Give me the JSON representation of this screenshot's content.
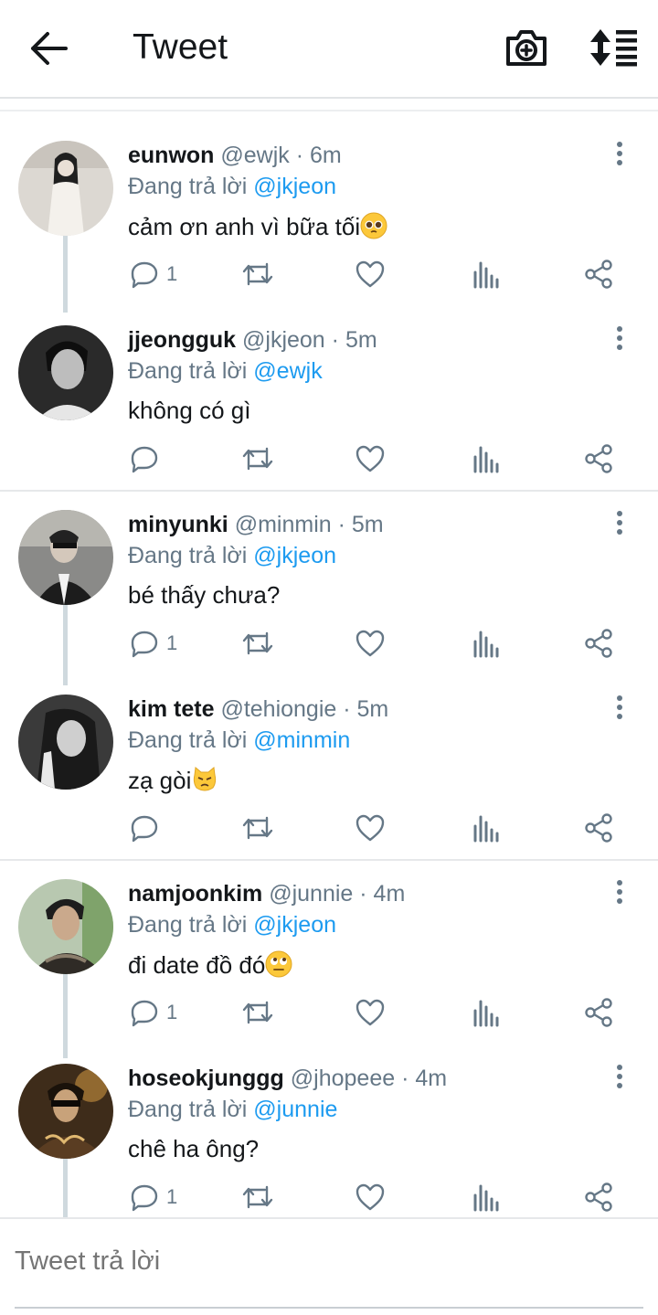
{
  "header": {
    "title": "Tweet",
    "back_icon": "arrow-left-icon",
    "camera_icon": "camera-plus-icon",
    "sort_icon": "sort-list-icon"
  },
  "colors": {
    "accent": "#1d9bf0",
    "muted": "#657786",
    "text": "#14171a",
    "thread_line": "#cfd9de"
  },
  "tweets": [
    {
      "name": "eunwon",
      "handle": "@ewjk",
      "time": "· 6m",
      "reply_prefix": "Đang trả lời",
      "reply_to": "@jkjeon",
      "text": "cảm ơn anh vì bữa tối",
      "emoji": "pleading-face",
      "reply_count": "1"
    },
    {
      "name": "jjeongguk",
      "handle": "@jkjeon",
      "time": "· 5m",
      "reply_prefix": "Đang trả lời",
      "reply_to": "@ewjk",
      "text": "không có gì",
      "emoji": "",
      "reply_count": ""
    },
    {
      "name": "minyunki",
      "handle": "@minmin",
      "time": "· 5m",
      "reply_prefix": "Đang trả lời",
      "reply_to": "@jkjeon",
      "text": "bé thấy chưa?",
      "emoji": "",
      "reply_count": "1"
    },
    {
      "name": "kim tete",
      "handle": "@tehiongie",
      "time": "· 5m",
      "reply_prefix": "Đang trả lời",
      "reply_to": "@minmin",
      "text": "zạ gòi",
      "emoji": "pouting-cat",
      "reply_count": ""
    },
    {
      "name": "namjoonkim",
      "handle": "@junnie",
      "time": "· 4m",
      "reply_prefix": "Đang trả lời",
      "reply_to": "@jkjeon",
      "text": "đi date đồ đó",
      "emoji": "face-rolling-eyes",
      "reply_count": "1"
    },
    {
      "name": "hoseokjunggg",
      "handle": "@jhopeee",
      "time": "· 4m",
      "reply_prefix": "Đang trả lời",
      "reply_to": "@junnie",
      "text": "chê ha ông?",
      "emoji": "",
      "reply_count": "1"
    }
  ],
  "reply": {
    "placeholder": "Tweet trả lời"
  }
}
